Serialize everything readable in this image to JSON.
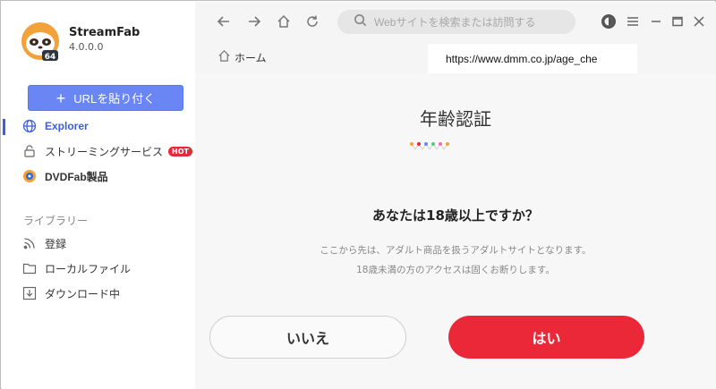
{
  "app": {
    "name": "StreamFab",
    "version": "4.0.0.0",
    "badge": "64"
  },
  "sidebar": {
    "url_button": "URLを貼り付く",
    "items": [
      {
        "label": "Explorer",
        "icon": "globe-icon",
        "active": true
      },
      {
        "label": "ストリーミングサービス",
        "icon": "lock-icon",
        "badge": "HOT"
      },
      {
        "label": "DVDFab製品",
        "icon": "dvdfab-icon"
      }
    ],
    "library_title": "ライブラリー",
    "library_items": [
      {
        "label": "登録",
        "icon": "rss-icon"
      },
      {
        "label": "ローカルファイル",
        "icon": "folder-icon"
      },
      {
        "label": "ダウンロード中",
        "icon": "download-icon"
      }
    ]
  },
  "search": {
    "placeholder": "Webサイトを検索または訪問する"
  },
  "tabs": {
    "home": "ホーム"
  },
  "address": {
    "url": "https://www.dmm.co.jp/age_che"
  },
  "age_check": {
    "title": "年齢認証",
    "question": "あなたは18歳以上ですか？",
    "note_line1": "ここから先は、アダルト商品を扱うアダルトサイトとなります。",
    "note_line2": "18歳未満の方のアクセスは固くお断りします。",
    "no_button": "いいえ",
    "yes_button": "はい"
  },
  "colors": {
    "accent": "#3d5fd9",
    "button_blue": "#6a86f4",
    "yes_red": "#ea2837",
    "hot_red": "#e8283a"
  }
}
